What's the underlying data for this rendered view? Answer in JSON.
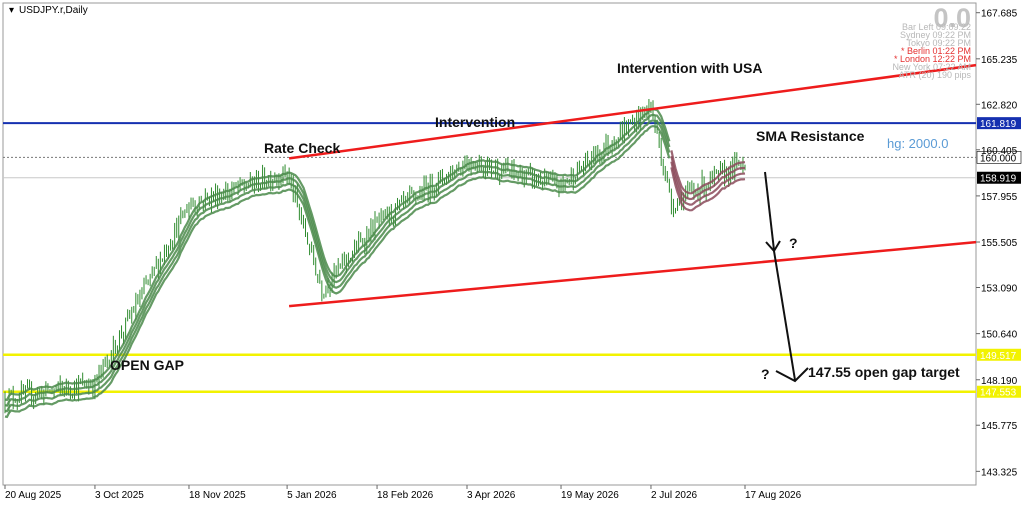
{
  "window": {
    "title": "USDJPY.r,Daily"
  },
  "info_panel": {
    "big_value": "0.0",
    "lines": [
      {
        "text": "Bar Left  09:09:22",
        "color": "#b8b8b8"
      },
      {
        "text": "Sydney  09:22 PM",
        "color": "#b8b8b8"
      },
      {
        "text": "Tokyo  09:22 PM",
        "color": "#b8b8b8"
      },
      {
        "text": "* Berlin  01:22 PM",
        "color": "#e53030"
      },
      {
        "text": "* London  12:22 PM",
        "color": "#e53030"
      },
      {
        "text": "New York  07:22 AM",
        "color": "#b8b8b8"
      },
      {
        "text": "ATR (20)  190 pips",
        "color": "#b8b8b8"
      }
    ]
  },
  "colors": {
    "candles": "#2e8b2e",
    "sma_bands": "#4a8a4a",
    "sma_bands_late": "#8b4a5a",
    "channel": "#ee1c1c",
    "blue_line": "#1530b0",
    "gap_line": "#f2f200",
    "arrow": "#111111",
    "hg_label": "#5b9bd5"
  },
  "chart_data": {
    "type": "line",
    "title": "USDJPY.r,Daily",
    "xlabel": "",
    "ylabel": "",
    "x_ticks": [
      "20 Aug 2025",
      "3 Oct 2025",
      "18 Nov 2025",
      "5 Jan 2026",
      "18 Feb 2026",
      "3 Apr 2026",
      "19 May 2026",
      "2 Jul 2026",
      "17 Aug 2026"
    ],
    "y_ticks": [
      167.685,
      165.235,
      162.82,
      160.405,
      157.955,
      155.505,
      153.09,
      150.64,
      148.19,
      145.775,
      143.325
    ],
    "ylim": [
      142.6,
      168.2
    ],
    "grid": false,
    "series": [
      {
        "x": [
          "20 Aug 2025",
          "3 Oct 2025",
          "18 Nov 2025",
          "5 Jan 2026",
          "22 Jan 2026",
          "18 Feb 2026",
          "3 Apr 2026",
          "19 May 2026",
          "2 Jul 2026",
          "12 Jul 2026",
          "17 Aug 2026"
        ],
        "values": [
          147.2,
          148.0,
          157.5,
          159.2,
          153.0,
          156.5,
          159.8,
          158.5,
          162.7,
          157.5,
          159.8
        ]
      }
    ],
    "horizontal_levels": [
      {
        "value": 161.819,
        "label": "161.819",
        "role": "blue"
      },
      {
        "value": 160.0,
        "label": "160.000",
        "role": "dotted"
      },
      {
        "value": 158.919,
        "label": "158.919",
        "role": "current"
      },
      {
        "value": 149.517,
        "label": "149.517",
        "role": "gap"
      },
      {
        "value": 147.553,
        "label": "147.553",
        "role": "gap"
      }
    ],
    "channel_lines": [
      {
        "from": [
          "5 Jan 2026",
          159.95
        ],
        "to": [
          "end",
          164.9
        ]
      },
      {
        "from": [
          "5 Jan 2026",
          152.1
        ],
        "to": [
          "end",
          155.5
        ]
      }
    ],
    "annotations": {
      "rate_check": "Rate Check",
      "intervention": "Intervention",
      "intervention_usa": "Intervention with USA",
      "sma_resistance": "SMA Resistance",
      "hg": "hg: 2000.0",
      "open_gap": "OPEN GAP",
      "gap_target": "147.55 open gap target",
      "q1": "?",
      "q2": "?"
    }
  }
}
